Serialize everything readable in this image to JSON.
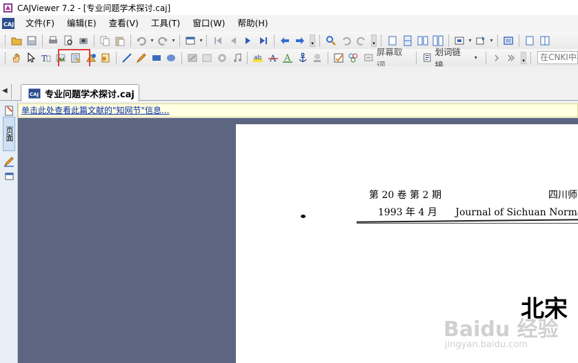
{
  "window": {
    "title": "CAJViewer 7.2 - [专业问题学术探讨.caj]"
  },
  "menubar": {
    "items": [
      "文件(F)",
      "编辑(E)",
      "查看(V)",
      "工具(T)",
      "窗口(W)",
      "帮助(H)"
    ]
  },
  "toolbar2": {
    "screen_ocr_label": "屏幕取词",
    "word_link_label": "划词链接",
    "search_placeholder": "在CNKI中检"
  },
  "tabs": [
    {
      "label": "专业问题学术探讨.caj",
      "active": true
    }
  ],
  "leftbar": {
    "page_tab_label": "页面"
  },
  "infobar": {
    "text": "单击此处查看此篇文献的\"知网节\"信息..."
  },
  "document": {
    "header_line1": "第 20 卷   第 2 期",
    "header_line1_journal": "四川师",
    "header_line2": "1993 年 4 月",
    "header_line2_journal": "Journal of Sichuan Norma",
    "title_fragment": "北宋"
  },
  "watermark": {
    "main": "Baidu 经验",
    "sub": "jingyan.baidu.com"
  },
  "colors": {
    "highlight": "#e23b3b",
    "viewer_bg": "#5d6681",
    "link": "#0b2fa8"
  }
}
